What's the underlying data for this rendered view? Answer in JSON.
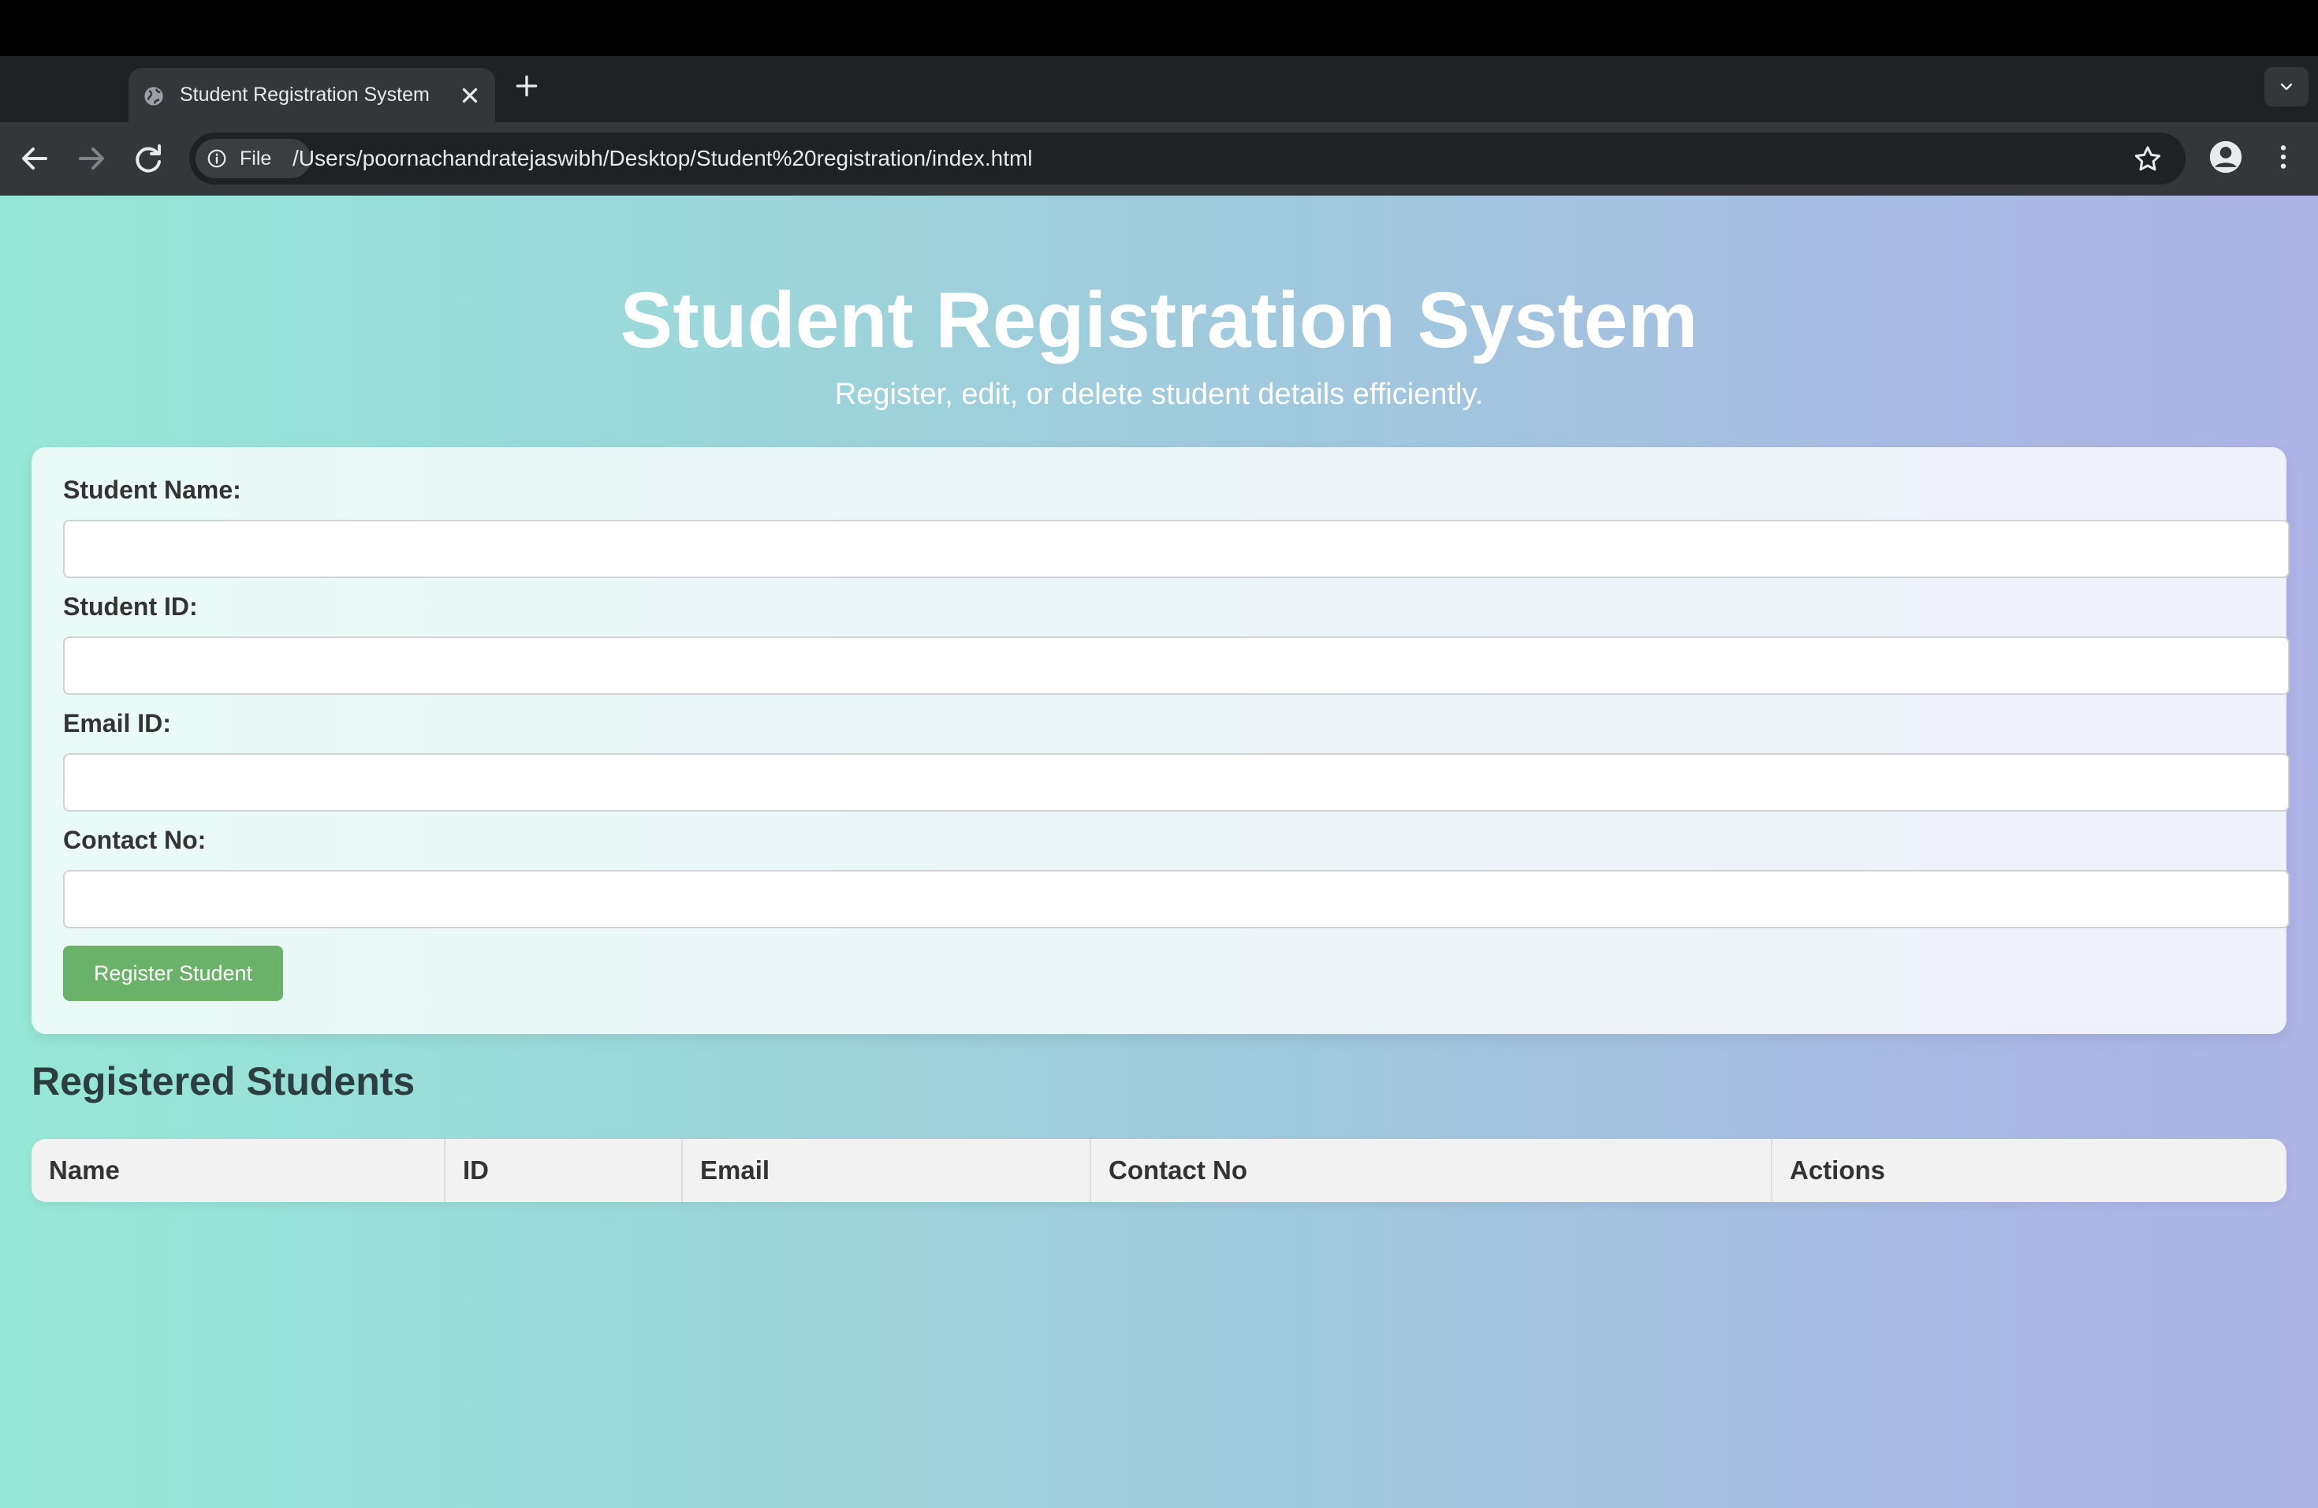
{
  "browser": {
    "tab_title": "Student Registration System",
    "file_chip": "File",
    "url": "/Users/poornachandratejaswibh/Desktop/Student%20registration/index.html"
  },
  "header": {
    "title": "Student Registration System",
    "subtitle": "Register, edit, or delete student details efficiently."
  },
  "form": {
    "fields": [
      {
        "label": "Student Name:",
        "value": ""
      },
      {
        "label": "Student ID:",
        "value": ""
      },
      {
        "label": "Email ID:",
        "value": ""
      },
      {
        "label": "Contact No:",
        "value": ""
      }
    ],
    "submit_label": "Register Student",
    "submit_color": "#6ab26a"
  },
  "students": {
    "title": "Registered Students",
    "columns": [
      "Name",
      "ID",
      "Email",
      "Contact No",
      "Actions"
    ],
    "rows": []
  },
  "theme": {
    "gradient_start": "#96e8d6",
    "gradient_end": "#adb3e6"
  }
}
